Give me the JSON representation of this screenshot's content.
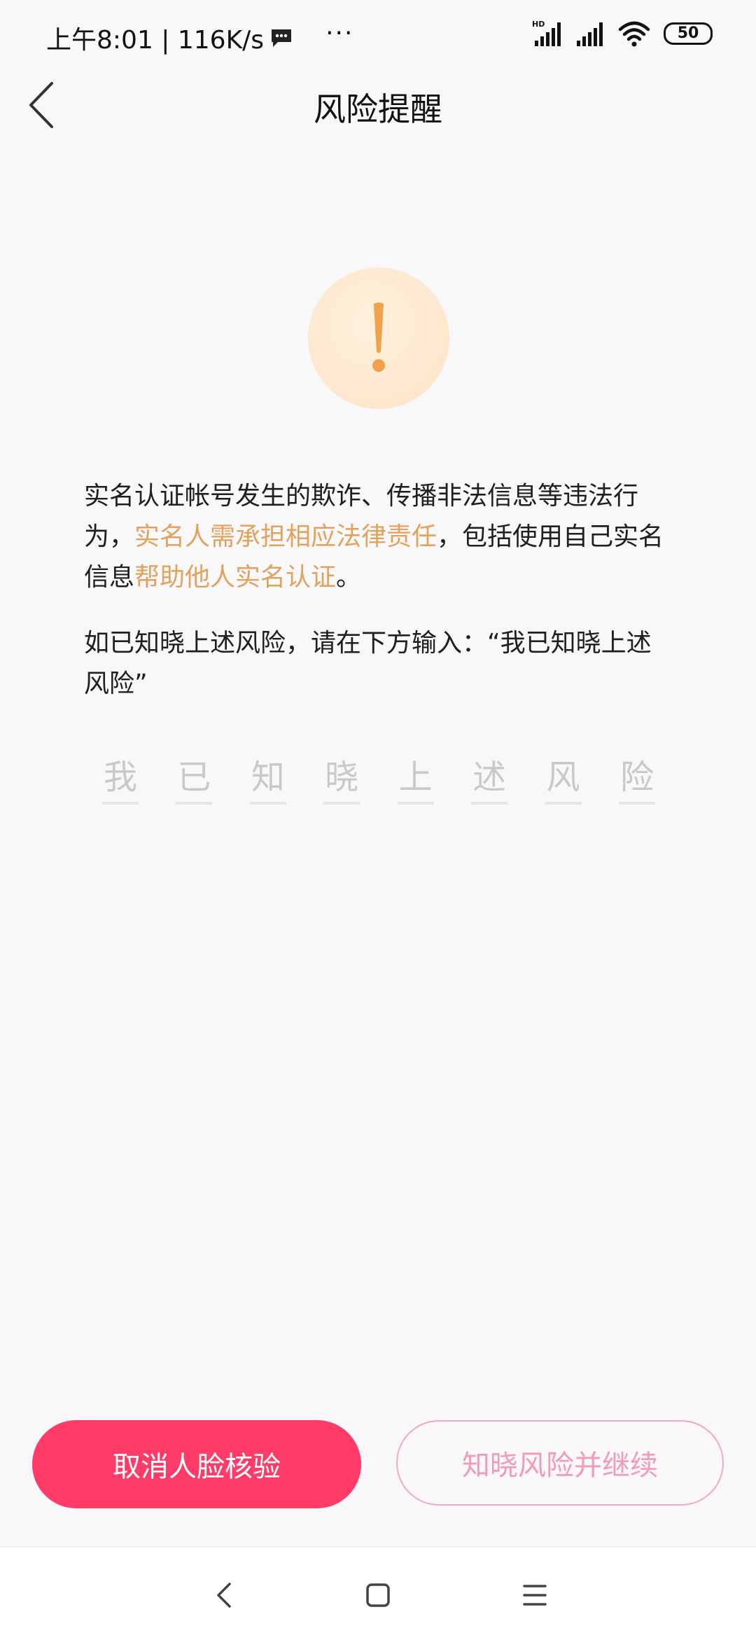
{
  "status_bar": {
    "time_speed": "上午8:01 | 116K/s",
    "more": "···",
    "network_hd": "HD",
    "battery": "50"
  },
  "header": {
    "title": "风险提醒"
  },
  "warning": {
    "symbol": "!"
  },
  "body": {
    "p1_part1": "实名认证帐号发生的欺诈、传播非法信息等违法行为，",
    "p1_highlight1": "实名人需承担相应法律责任",
    "p1_part2": "，包括使用自己实名信息",
    "p1_highlight2": "帮助他人实名认证",
    "p1_part3": "。",
    "p2": "如已知晓上述风险，请在下方输入：“我已知晓上述风险”"
  },
  "input_chars": [
    "我",
    "已",
    "知",
    "晓",
    "上",
    "述",
    "风",
    "险"
  ],
  "buttons": {
    "cancel": "取消人脸核验",
    "continue": "知晓风险并继续"
  },
  "colors": {
    "accent_pink": "#ff3b68",
    "highlight_orange": "#e2a25c",
    "warning_orange": "#f0a24a"
  },
  "icons": {
    "back": "chevron-left-icon",
    "message": "message-icon",
    "signal": "signal-icon",
    "wifi": "wifi-icon",
    "battery": "battery-icon",
    "nav_back": "nav-back-icon",
    "nav_home": "nav-home-icon",
    "nav_menu": "nav-menu-icon"
  }
}
